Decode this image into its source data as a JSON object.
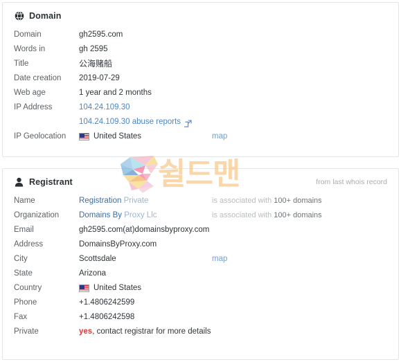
{
  "domain_card": {
    "icon": "globe-icon",
    "title": "Domain",
    "rows": [
      {
        "label": "Domain",
        "value": "gh2595.com"
      },
      {
        "label": "Words in",
        "value": "gh 2595"
      },
      {
        "label": "Title",
        "value": "公海赌船"
      },
      {
        "label": "Date creation",
        "value": "2019-07-29"
      },
      {
        "label": "Web age",
        "value": "1 year and 2 months"
      }
    ],
    "ip_label": "IP Address",
    "ip_value": "104.24.109.30",
    "ip_abuse_link": "104.24.109.30 abuse reports",
    "ip_abuse_icon": "external-link-icon",
    "geo_label": "IP Geolocation",
    "geo_flag": "us-flag-icon",
    "geo_value": "United States",
    "geo_map_link": "map"
  },
  "registrant_card": {
    "icon": "user-icon",
    "title": "Registrant",
    "note": "from last whois record",
    "name_label": "Name",
    "name_value_main": "Registration",
    "name_value_sub": "Private",
    "name_assoc_prefix": "is associated with ",
    "name_assoc_count": "100+ domains",
    "org_label": "Organization",
    "org_value_main": "Domains By",
    "org_value_sub": "Proxy Llc",
    "org_assoc_prefix": "is associated with ",
    "org_assoc_count": "100+ domains",
    "rows": [
      {
        "label": "Email",
        "value": "gh2595.com(at)domainsbyproxy.com"
      },
      {
        "label": "Address",
        "value": "DomainsByProxy.com"
      }
    ],
    "city_label": "City",
    "city_value": "Scottsdale",
    "city_map_link": "map",
    "state_label": "State",
    "state_value": "Arizona",
    "country_label": "Country",
    "country_flag": "us-flag-icon",
    "country_value": "United States",
    "phone_label": "Phone",
    "phone_value": "+1.4806242599",
    "fax_label": "Fax",
    "fax_value": "+1.4806242598",
    "private_label": "Private",
    "private_flag": "yes",
    "private_rest": ", contact registrar for more details"
  },
  "watermark": {
    "logo": "shieldman-s-logo",
    "text": "쉴드맨"
  },
  "colors": {
    "link": "#4a87c4",
    "link_soft": "#9db6cf",
    "map_link": "#6f9fd0",
    "danger": "#e03b37",
    "muted": "#b8bcbf",
    "border": "#e3e6e8",
    "watermark": "#f8c98b"
  }
}
